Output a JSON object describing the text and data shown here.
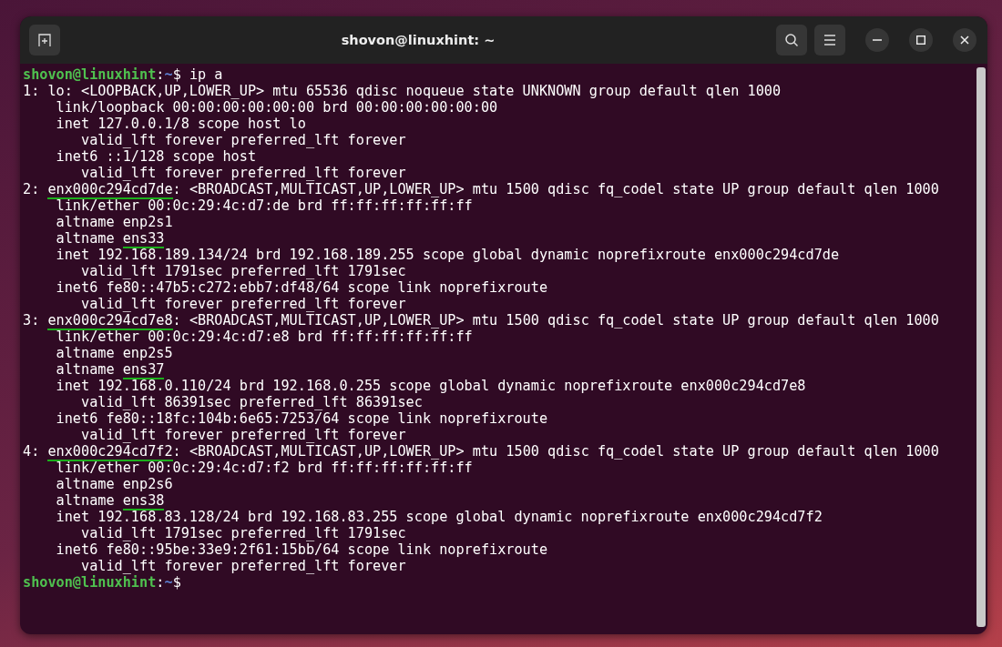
{
  "window": {
    "title": "shovon@linuxhint: ~"
  },
  "terminal": {
    "lines": [
      [
        {
          "kind": "user",
          "text": "shovon@linuxhint"
        },
        {
          "kind": "plain",
          "text": ":"
        },
        {
          "kind": "path",
          "text": "~"
        },
        {
          "kind": "plain",
          "text": "$ ip a"
        }
      ],
      [
        {
          "kind": "plain",
          "text": "1: lo: <LOOPBACK,UP,LOWER_UP> mtu 65536 qdisc noqueue state UNKNOWN group default qlen 1000"
        }
      ],
      [
        {
          "kind": "plain",
          "text": "    link/loopback 00:00:00:00:00:00 brd 00:00:00:00:00:00"
        }
      ],
      [
        {
          "kind": "plain",
          "text": "    inet 127.0.0.1/8 scope host lo"
        }
      ],
      [
        {
          "kind": "plain",
          "text": "       valid_lft forever preferred_lft forever"
        }
      ],
      [
        {
          "kind": "plain",
          "text": "    inet6 ::1/128 scope host"
        }
      ],
      [
        {
          "kind": "plain",
          "text": "       valid_lft forever preferred_lft forever"
        }
      ],
      [
        {
          "kind": "plain",
          "text": "2: "
        },
        {
          "kind": "underlined",
          "text": "enx000c294cd7de"
        },
        {
          "kind": "plain",
          "text": ": <BROADCAST,MULTICAST,UP,LOWER_UP> mtu 1500 qdisc fq_codel state UP group default qlen 1000"
        }
      ],
      [
        {
          "kind": "plain",
          "text": "    link/ether 00:0c:29:4c:d7:de brd ff:ff:ff:ff:ff:ff"
        }
      ],
      [
        {
          "kind": "plain",
          "text": "    altname enp2s1"
        }
      ],
      [
        {
          "kind": "plain",
          "text": "    altname "
        },
        {
          "kind": "underlined",
          "text": "ens33"
        }
      ],
      [
        {
          "kind": "plain",
          "text": "    inet 192.168.189.134/24 brd 192.168.189.255 scope global dynamic noprefixroute enx000c294cd7de"
        }
      ],
      [
        {
          "kind": "plain",
          "text": "       valid_lft 1791sec preferred_lft 1791sec"
        }
      ],
      [
        {
          "kind": "plain",
          "text": "    inet6 fe80::47b5:c272:ebb7:df48/64 scope link noprefixroute"
        }
      ],
      [
        {
          "kind": "plain",
          "text": "       valid_lft forever preferred_lft forever"
        }
      ],
      [
        {
          "kind": "plain",
          "text": "3: "
        },
        {
          "kind": "underlined",
          "text": "enx000c294cd7e8"
        },
        {
          "kind": "plain",
          "text": ": <BROADCAST,MULTICAST,UP,LOWER_UP> mtu 1500 qdisc fq_codel state UP group default qlen 1000"
        }
      ],
      [
        {
          "kind": "plain",
          "text": "    link/ether 00:0c:29:4c:d7:e8 brd ff:ff:ff:ff:ff:ff"
        }
      ],
      [
        {
          "kind": "plain",
          "text": "    altname enp2s5"
        }
      ],
      [
        {
          "kind": "plain",
          "text": "    altname "
        },
        {
          "kind": "underlined",
          "text": "ens37"
        }
      ],
      [
        {
          "kind": "plain",
          "text": "    inet 192.168.0.110/24 brd 192.168.0.255 scope global dynamic noprefixroute enx000c294cd7e8"
        }
      ],
      [
        {
          "kind": "plain",
          "text": "       valid_lft 86391sec preferred_lft 86391sec"
        }
      ],
      [
        {
          "kind": "plain",
          "text": "    inet6 fe80::18fc:104b:6e65:7253/64 scope link noprefixroute"
        }
      ],
      [
        {
          "kind": "plain",
          "text": "       valid_lft forever preferred_lft forever"
        }
      ],
      [
        {
          "kind": "plain",
          "text": "4: "
        },
        {
          "kind": "underlined",
          "text": "enx000c294cd7f2"
        },
        {
          "kind": "plain",
          "text": ": <BROADCAST,MULTICAST,UP,LOWER_UP> mtu 1500 qdisc fq_codel state UP group default qlen 1000"
        }
      ],
      [
        {
          "kind": "plain",
          "text": "    link/ether 00:0c:29:4c:d7:f2 brd ff:ff:ff:ff:ff:ff"
        }
      ],
      [
        {
          "kind": "plain",
          "text": "    altname enp2s6"
        }
      ],
      [
        {
          "kind": "plain",
          "text": "    altname "
        },
        {
          "kind": "underlined",
          "text": "ens38"
        }
      ],
      [
        {
          "kind": "plain",
          "text": "    inet 192.168.83.128/24 brd 192.168.83.255 scope global dynamic noprefixroute enx000c294cd7f2"
        }
      ],
      [
        {
          "kind": "plain",
          "text": "       valid_lft 1791sec preferred_lft 1791sec"
        }
      ],
      [
        {
          "kind": "plain",
          "text": "    inet6 fe80::95be:33e9:2f61:15bb/64 scope link noprefixroute"
        }
      ],
      [
        {
          "kind": "plain",
          "text": "       valid_lft forever preferred_lft forever"
        }
      ],
      [
        {
          "kind": "user",
          "text": "shovon@linuxhint"
        },
        {
          "kind": "plain",
          "text": ":"
        },
        {
          "kind": "path",
          "text": "~"
        },
        {
          "kind": "plain",
          "text": "$"
        }
      ]
    ]
  }
}
